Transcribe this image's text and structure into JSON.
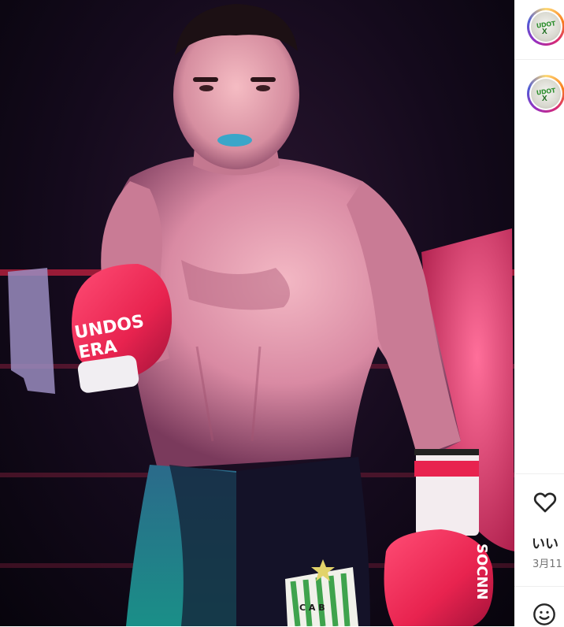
{
  "post": {
    "image_alt": "",
    "glove_text_line1": "UNDOS",
    "glove_text_line2": "ERA",
    "glove_text_right": "SOCNN",
    "shorts_badge_letters": "C A B"
  },
  "sidebar": {
    "avatars": [
      {
        "label": "UDOT",
        "icon": "profile-avatar"
      },
      {
        "label": "UDOT",
        "icon": "profile-avatar"
      }
    ],
    "likes_text": "いい",
    "date_text": "3月11",
    "icons": {
      "like": "heart-icon",
      "comment": "emoji-icon"
    }
  },
  "colors": {
    "glove_red": "#e8234f",
    "ring_gradient": [
      "#feda75",
      "#fa7e1e",
      "#d62976",
      "#962fbf",
      "#4f5bd5"
    ],
    "text_primary": "#262626",
    "text_secondary": "#737373"
  }
}
